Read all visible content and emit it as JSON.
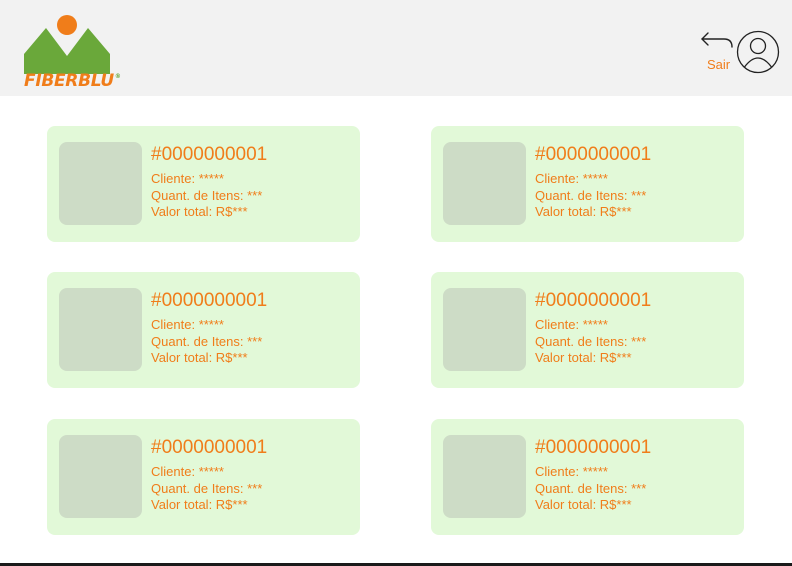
{
  "header": {
    "brand": "FIBERBLU",
    "brand_mark": "®",
    "exit_label": "Sair",
    "exit_icon": "back-arrow-icon",
    "avatar_icon": "user-avatar-icon"
  },
  "colors": {
    "accent": "#f07d1a",
    "card_bg": "#e2f9d8",
    "thumb_bg": "#cddcc6",
    "logo_green": "#6aa83a",
    "header_bg": "#f2f2f2"
  },
  "orders": [
    {
      "id": "#0000000001",
      "client": "Cliente: *****",
      "items": "Quant. de Itens: ***",
      "total": "Valor total: R$***"
    },
    {
      "id": "#0000000001",
      "client": "Cliente: *****",
      "items": "Quant. de Itens: ***",
      "total": "Valor total: R$***"
    },
    {
      "id": "#0000000001",
      "client": "Cliente: *****",
      "items": "Quant. de Itens: ***",
      "total": "Valor total: R$***"
    },
    {
      "id": "#0000000001",
      "client": "Cliente: *****",
      "items": "Quant. de Itens: ***",
      "total": "Valor total: R$***"
    },
    {
      "id": "#0000000001",
      "client": "Cliente: *****",
      "items": "Quant. de Itens: ***",
      "total": "Valor total: R$***"
    },
    {
      "id": "#0000000001",
      "client": "Cliente: *****",
      "items": "Quant. de Itens: ***",
      "total": "Valor total: R$***"
    }
  ]
}
